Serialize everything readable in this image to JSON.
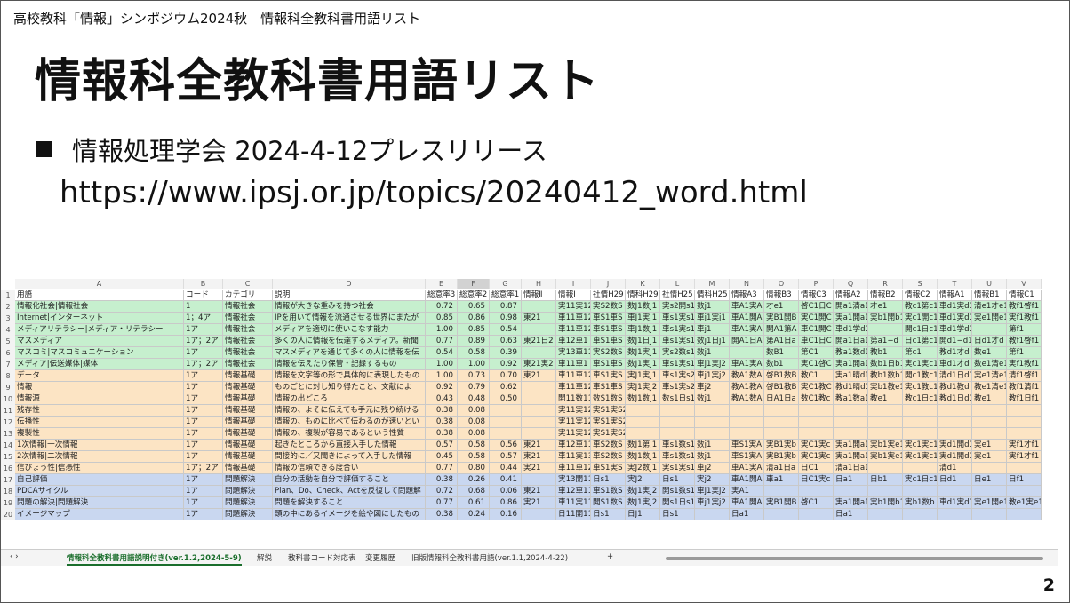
{
  "slide": {
    "header_text": "高校教科「情報」シンポジウム2024秋　情報科全教科書用語リスト",
    "title": "情報科全教科書用語リスト",
    "bullet": "情報処理学会 2024-4-12プレスリリース",
    "url": "https://www.ipsj.or.jp/topics/20240412_word.html",
    "page_number": "2"
  },
  "sheet": {
    "column_letters": [
      "A",
      "B",
      "C",
      "D",
      "E",
      "F",
      "G",
      "H",
      "I",
      "J",
      "K",
      "L",
      "M",
      "N",
      "O",
      "P",
      "Q",
      "R",
      "S",
      "T",
      "U",
      "V"
    ],
    "selected_column": "F",
    "row_numbers": [
      "1",
      "2",
      "3",
      "4",
      "5",
      "6",
      "7",
      "8",
      "9",
      "10",
      "11",
      "12",
      "13",
      "14",
      "15",
      "16",
      "17",
      "18",
      "19",
      "20"
    ],
    "header_row": [
      "用語",
      "コード",
      "カテゴリ",
      "説明",
      "総意率3",
      "総意率2",
      "総意率1",
      "情報Ⅱ",
      "情報Ⅰ",
      "社情H29",
      "情科H29",
      "社情H25",
      "情科H25",
      "情報A3",
      "情報B3",
      "情報C3",
      "情報A2",
      "情報B2",
      "情報C2",
      "情報A1",
      "情報B1",
      "情報C1"
    ],
    "row_colors": [
      "#c6efce",
      "#c6efce",
      "#c6efce",
      "#c6efce",
      "#c6efce",
      "#c6efce",
      "#fce4c4",
      "#fce4c4",
      "#fce4c4",
      "#fce4c4",
      "#fce4c4",
      "#fce4c4",
      "#fce4c4",
      "#fce4c4",
      "#fce4c4",
      "#c9d7f0",
      "#c9d7f0",
      "#c9d7f0",
      "#c9d7f0"
    ],
    "rows": [
      [
        "情報化社会|情報社会",
        "1",
        "情報社会",
        "情報が大きな重みを持つ社会",
        "0.72",
        "0.65",
        "0.87",
        "",
        "実11実12",
        "実S2数S",
        "数J1数J1",
        "実s2開s1",
        "数j1",
        "車A1実A",
        "才e1",
        "啓C1日C",
        "開a1清a1",
        "才e1",
        "教c1第c1",
        "車d1実d1",
        "清e1才e1",
        "教f1啓f1"
      ],
      [
        "Internet|インターネット",
        "1；4ア",
        "情報社会",
        "IPを用いて情報を流通させる世界にまたが",
        "0.85",
        "0.86",
        "0.98",
        "東21",
        "車11車12",
        "車S1車S",
        "車J1実J1",
        "車s1実s1",
        "車j1実j1",
        "車A1開A",
        "実B1開B",
        "実C1開C",
        "実a1開a1",
        "実b1開b1",
        "実c1開c1",
        "車d1実d1",
        "実e1開e1",
        "実f1教f1"
      ],
      [
        "メディアリテラシー|メディア・リテラシー",
        "1ア",
        "情報社会",
        "メディアを適切に使いこなす能力",
        "1.00",
        "0.85",
        "0.54",
        "",
        "車11車12",
        "車S1車S",
        "車J1数J1",
        "車s1実s1",
        "車j1",
        "車A1実A2",
        "開A1第A",
        "車C1開C",
        "車d1学d1",
        "",
        "開c1日c1",
        "車d1学d1",
        "",
        "第f1"
      ],
      [
        "マスメディア",
        "1ア；2ア",
        "情報社会",
        "多くの人に情報を伝達するメディア。新聞",
        "0.77",
        "0.89",
        "0.63",
        "東21日2",
        "車12車1",
        "車S1車S",
        "数J1日J1",
        "車s1実s1",
        "数j1日j1",
        "開A1日A1",
        "第A1日a",
        "車C1日C",
        "開a1日a1",
        "第a1−d",
        "日c1第c1",
        "開d1−d1",
        "日d1才d",
        "教f1啓f1"
      ],
      [
        "マスコミ|マスコミュニケーション",
        "1ア",
        "情報社会",
        "マスメディアを通じて多くの人に情報を伝",
        "0.54",
        "0.58",
        "0.39",
        "",
        "実13車11",
        "実S2数S",
        "数J1実J1",
        "実s2数s1",
        "数j1",
        "",
        "数B1",
        "第C1",
        "教a1数d1",
        "教b1",
        "第c1",
        "教d1才d",
        "数e1",
        "第f1"
      ],
      [
        "メディア|伝送媒体|媒体",
        "1ア；2ア",
        "情報社会",
        "情報を伝えたり保管・記録するもの",
        "1.00",
        "1.00",
        "0.92",
        "東21実2",
        "車11車1",
        "車S1車S",
        "数J1実J1",
        "車s1実s1",
        "車j1実j2",
        "車A1実A",
        "数b1",
        "実C1啓C",
        "実a1開a1",
        "数b1日b1",
        "実c1実c1",
        "車d1才d",
        "数e1清e1",
        "実f1教f1"
      ],
      [
        "データ",
        "1ア",
        "情報基礎",
        "情報を文字等の形で具体的に表現したもの",
        "1.00",
        "0.73",
        "0.70",
        "東21",
        "車11車12",
        "車S1実S",
        "実J1実J1",
        "車s1実s2",
        "車j1実j2",
        "教A1数A",
        "啓B1数B",
        "教C1",
        "実a1晴d1",
        "教b1数b1",
        "開c1教c1",
        "清d1日d1",
        "実e1清e1",
        "清f1啓f1"
      ],
      [
        "情報",
        "1ア",
        "情報基礎",
        "ものごとに対し知り得たこと、文献によ",
        "0.92",
        "0.79",
        "0.62",
        "",
        "車11車12",
        "車S1車S",
        "実J1実J2",
        "車s1実s2",
        "車j2",
        "教A1教A",
        "啓B1教B",
        "実C1教C",
        "教d1晴d1",
        "実b1教e1",
        "実c1教c1",
        "教d1教d",
        "教e1清e1",
        "教f1清f1"
      ],
      [
        "情報源",
        "1ア",
        "情報基礎",
        "情報の出どころ",
        "0.43",
        "0.48",
        "0.50",
        "",
        "開11数11",
        "数S1数S",
        "数J1数j1",
        "数s1日s1",
        "数j1",
        "教A1数A1",
        "日A1日a",
        "数C1教c",
        "教a1数a1",
        "教e1",
        "教c1日c1",
        "教d1日d1",
        "教e1",
        "教f1日f1"
      ],
      [
        "残存性",
        "1ア",
        "情報基礎",
        "情報の、よそに伝えても手元に残り続ける",
        "0.38",
        "0.08",
        "",
        "",
        "実11実12",
        "実S1実S2",
        "",
        "",
        "",
        "",
        "",
        "",
        "",
        "",
        "",
        "",
        "",
        ""
      ],
      [
        "伝播性",
        "1ア",
        "情報基礎",
        "情報の、ものに比べて伝わるのが速いとい",
        "0.38",
        "0.08",
        "",
        "",
        "実11実12",
        "実S1実S2",
        "",
        "",
        "",
        "",
        "",
        "",
        "",
        "",
        "",
        "",
        "",
        ""
      ],
      [
        "複製性",
        "1ア",
        "情報基礎",
        "情報の、複製が容易であるという性質",
        "0.38",
        "0.08",
        "",
        "",
        "実11実12",
        "実S1実S2",
        "",
        "",
        "",
        "",
        "",
        "",
        "",
        "",
        "",
        "",
        "",
        ""
      ],
      [
        "1次情報|一次情報",
        "1ア",
        "情報基礎",
        "起きたところから直接入手した情報",
        "0.57",
        "0.58",
        "0.56",
        "東21",
        "車12車11",
        "車S2数S",
        "数J1第J1",
        "車s1数s1",
        "数j1",
        "車S1実A",
        "実B1実b",
        "実C1実c",
        "実a1開a1",
        "実b1実e1",
        "実c1実c1",
        "実d1開d1",
        "実e1",
        "実f1才f1"
      ],
      [
        "2次情報|二次情報",
        "1ア",
        "情報基礎",
        "間接的に／又聞きによって入手した情報",
        "0.45",
        "0.58",
        "0.57",
        "東21",
        "車11実13",
        "車S2数S",
        "数J1数J1",
        "車s1数s1",
        "数j1",
        "車S1実A",
        "実B1実b",
        "実C1実c",
        "実a1開a1",
        "実b1実e1",
        "実c1実c1",
        "実d1開d1",
        "実e1",
        "実f1才f1"
      ],
      [
        "信ぴょう性|信憑性",
        "1ア；2ア",
        "情報基礎",
        "情報の信頼できる度合い",
        "0.77",
        "0.80",
        "0.44",
        "実21",
        "車11車12",
        "車S1実S",
        "実J2数J1",
        "実s1実s1",
        "車j2",
        "車A1実A2",
        "清a1日a",
        "日C1",
        "清a1日a1",
        "",
        "",
        "清d1",
        "",
        ""
      ],
      [
        "自己評価",
        "1ア",
        "問題解決",
        "自分の活動を自分で評価すること",
        "0.38",
        "0.26",
        "0.41",
        "",
        "実13開11",
        "日s1",
        "実J2",
        "日s1",
        "実j2",
        "車A1開A",
        "車a1",
        "日C1実c",
        "日a1",
        "日b1",
        "実c1日c1",
        "日d1",
        "日e1",
        "日f1"
      ],
      [
        "PDCAサイクル",
        "1ア",
        "問題解決",
        "Plan、Do、Check、Actを反復して問題解",
        "0.72",
        "0.68",
        "0.06",
        "東21",
        "車12車11",
        "車S1数S",
        "数J1実J2",
        "開s1数s1",
        "車j1実j2",
        "実A1",
        "",
        "",
        "",
        "",
        "",
        "",
        "",
        ""
      ],
      [
        "問題の解決|問題解決",
        "1ア",
        "問題解決",
        "問題を解決すること",
        "0.77",
        "0.61",
        "0.86",
        "実21",
        "車11実11",
        "開S1数S",
        "数J1実J2",
        "開s1日s1",
        "車j1実j2",
        "車A1開A",
        "実B1開B",
        "啓C1",
        "実a1開a1",
        "実b1開b1",
        "実b1数b",
        "車d1実d1",
        "実e1開e1",
        "教e1実e1"
      ],
      [
        "イメージマップ",
        "1ア",
        "問題解決",
        "頭の中にあるイメージを絵や図にしたもの",
        "0.38",
        "0.24",
        "0.16",
        "",
        "日11開11",
        "日s1",
        "日J1",
        "日s1",
        "",
        "日a1",
        "",
        "",
        "日a1",
        "",
        "",
        "",
        "",
        ""
      ]
    ],
    "tabs": [
      {
        "label": "‹ ›"
      },
      {
        "label": "情報科全教科書用語説明付き(ver.1.2,2024-5-9)"
      },
      {
        "label": "解説"
      },
      {
        "label": "教科書コード対応表"
      },
      {
        "label": "変更履歴"
      },
      {
        "label": "旧版情報科全教科書用語(ver.1.1,2024-4-22)"
      },
      {
        "label": "+"
      }
    ],
    "colors": {
      "green_row": "#c6efce",
      "orange_row": "#fce4c4",
      "blue_row": "#c9d7f0",
      "active_tab": "#1a6e2c"
    }
  }
}
